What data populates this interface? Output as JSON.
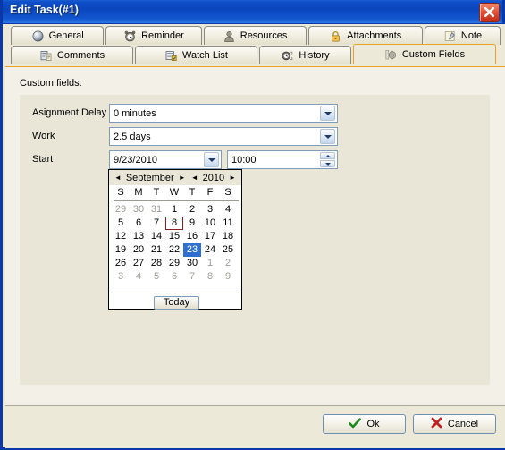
{
  "window": {
    "title": "Edit Task(#1)",
    "close_icon": "close-icon",
    "titlebar_color": "#0a46be",
    "face_color": "#ece9d8",
    "accent_color": "#e7a527"
  },
  "tabs": {
    "row1": [
      {
        "label": "General",
        "icon": "sphere-icon",
        "active": false
      },
      {
        "label": "Reminder",
        "icon": "alarm-clock-icon",
        "active": false
      },
      {
        "label": "Resources",
        "icon": "person-icon",
        "active": false
      },
      {
        "label": "Attachments",
        "icon": "padlock-icon",
        "active": false
      },
      {
        "label": "Note",
        "icon": "pushpin-note-icon",
        "active": false
      }
    ],
    "row2": [
      {
        "label": "Comments",
        "icon": "comment-lines-icon",
        "active": false
      },
      {
        "label": "Watch List",
        "icon": "binoculars-icon",
        "active": false
      },
      {
        "label": "History",
        "icon": "clock-history-icon",
        "active": false
      },
      {
        "label": "Custom Fields",
        "icon": "gear-icon",
        "active": true
      }
    ]
  },
  "main": {
    "section_label": "Custom fields:",
    "fields": [
      {
        "label": "Asignment Delay",
        "type": "combobox",
        "value": "0 minutes",
        "dropdown_icon": "chevron-down-icon"
      },
      {
        "label": "Work",
        "type": "combobox",
        "value": "2.5 days",
        "dropdown_icon": "chevron-down-icon"
      },
      {
        "label": "Start",
        "type": "datetime",
        "date_value": "9/23/2010",
        "date_dropdown_icon": "chevron-down-icon",
        "time_value": "10:00",
        "spinner_up_icon": "triangle-up-icon",
        "spinner_down_icon": "triangle-down-icon"
      }
    ]
  },
  "calendar": {
    "prev_month_icon": "triangle-left-icon",
    "next_month_icon": "triangle-right-icon",
    "prev_year_icon": "triangle-left-icon",
    "next_year_icon": "triangle-right-icon",
    "month": "September",
    "year": "2010",
    "day_headers": [
      "S",
      "M",
      "T",
      "W",
      "T",
      "F",
      "S"
    ],
    "weeks": [
      [
        {
          "d": "29",
          "state": "dim"
        },
        {
          "d": "30",
          "state": "dim"
        },
        {
          "d": "31",
          "state": "dim"
        },
        {
          "d": "1",
          "state": "normal"
        },
        {
          "d": "2",
          "state": "normal"
        },
        {
          "d": "3",
          "state": "normal"
        },
        {
          "d": "4",
          "state": "normal"
        }
      ],
      [
        {
          "d": "5",
          "state": "normal"
        },
        {
          "d": "6",
          "state": "normal"
        },
        {
          "d": "7",
          "state": "normal"
        },
        {
          "d": "8",
          "state": "today"
        },
        {
          "d": "9",
          "state": "normal"
        },
        {
          "d": "10",
          "state": "normal"
        },
        {
          "d": "11",
          "state": "normal"
        }
      ],
      [
        {
          "d": "12",
          "state": "normal"
        },
        {
          "d": "13",
          "state": "normal"
        },
        {
          "d": "14",
          "state": "normal"
        },
        {
          "d": "15",
          "state": "normal"
        },
        {
          "d": "16",
          "state": "normal"
        },
        {
          "d": "17",
          "state": "normal"
        },
        {
          "d": "18",
          "state": "normal"
        }
      ],
      [
        {
          "d": "19",
          "state": "normal"
        },
        {
          "d": "20",
          "state": "normal"
        },
        {
          "d": "21",
          "state": "normal"
        },
        {
          "d": "22",
          "state": "normal"
        },
        {
          "d": "23",
          "state": "sel"
        },
        {
          "d": "24",
          "state": "normal"
        },
        {
          "d": "25",
          "state": "normal"
        }
      ],
      [
        {
          "d": "26",
          "state": "normal"
        },
        {
          "d": "27",
          "state": "normal"
        },
        {
          "d": "28",
          "state": "normal"
        },
        {
          "d": "29",
          "state": "normal"
        },
        {
          "d": "30",
          "state": "normal"
        },
        {
          "d": "1",
          "state": "dim"
        },
        {
          "d": "2",
          "state": "dim"
        }
      ],
      [
        {
          "d": "3",
          "state": "dim"
        },
        {
          "d": "4",
          "state": "dim"
        },
        {
          "d": "5",
          "state": "dim"
        },
        {
          "d": "6",
          "state": "dim"
        },
        {
          "d": "7",
          "state": "dim"
        },
        {
          "d": "8",
          "state": "dim"
        },
        {
          "d": "9",
          "state": "dim"
        }
      ]
    ],
    "today_button": "Today",
    "selected_color": "#2f6fd0",
    "today_outline_color": "#8b2020"
  },
  "footer": {
    "ok_label": "Ok",
    "ok_icon": "green-check-icon",
    "cancel_label": "Cancel",
    "cancel_icon": "red-x-icon"
  }
}
